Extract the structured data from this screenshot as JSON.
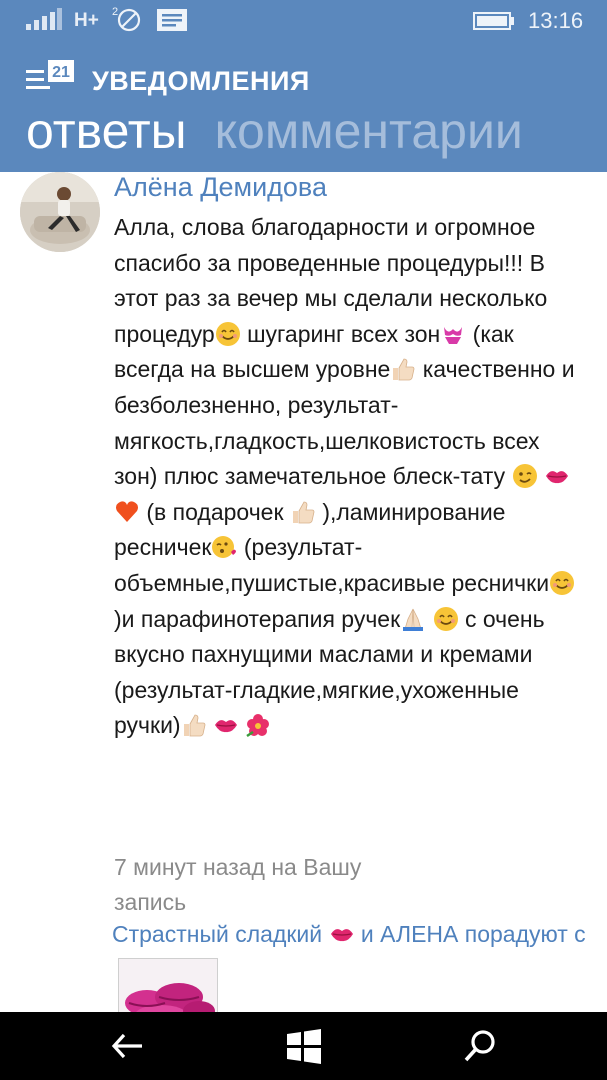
{
  "status_bar": {
    "network": "H+",
    "sim": "2",
    "time": "13:16"
  },
  "header": {
    "app_badge": "21",
    "title": "УВЕДОМЛЕНИЯ",
    "pivots": [
      {
        "label": "ответы",
        "active": true
      },
      {
        "label": "комментарии",
        "active": false
      }
    ],
    "color": "#5b88bd"
  },
  "notification": {
    "author": "Алёна Демидова",
    "text": {
      "p1": "Алла, слова благодарности и огромное спасибо за проведенные процедуры!!! В этот раз за вечер мы сделали несколько процедур",
      "p2": "шугаринг всех зон",
      "p3": " (как всегда на высшем уровне",
      "p4": " качественно и безболезненно, результат-мягкость,гладкость,шелковистость всех зон) плюс замечательное блеск-тату",
      "p5": "(в подарочек ",
      "p6": "),ламинирование ресничек",
      "p7": "(результат-объемные,пушистые,красивые реснички",
      "p8": ")и парафинотерапия ручек",
      "p9": " с очень вкусно пахнущими маслами и кремами (результат-гладкие,мягкие,ухоженные ручки)"
    },
    "emoji": [
      "smile",
      "bikini",
      "thumbs-up",
      "wink",
      "kiss-lips",
      "heart",
      "thumbs-up",
      "kiss-face",
      "smile",
      "praying-hands",
      "smile",
      "thumbs-up",
      "kiss-lips",
      "hibiscus"
    ],
    "time_meta": "7 минут назад на Вашу запись",
    "post_link_a": "Страстный сладкий ",
    "post_link_b": " и АЛЕНА порадуют с"
  },
  "nav_bar": {
    "buttons": [
      "back",
      "windows",
      "search"
    ]
  }
}
